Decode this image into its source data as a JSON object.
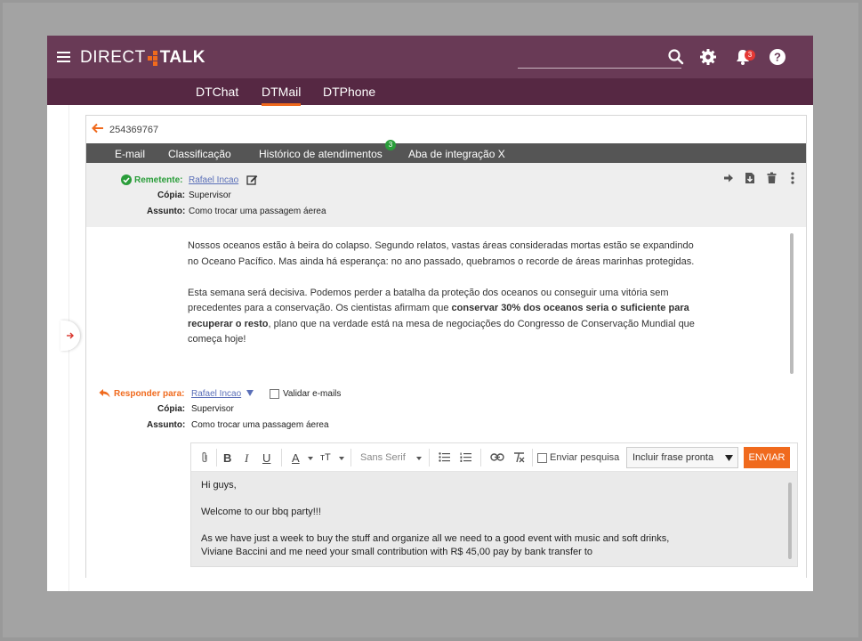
{
  "header": {
    "brand_left": "DIRECT",
    "brand_right": "TALK",
    "notification_count": "3",
    "icons": [
      "menu-icon",
      "search-icon",
      "gear-icon",
      "bell-icon",
      "help-icon"
    ]
  },
  "app_tabs": [
    {
      "label": "DTChat"
    },
    {
      "label": "DTMail"
    },
    {
      "label": "DTPhone"
    }
  ],
  "ticket": {
    "id": "254369767"
  },
  "sub_tabs": [
    {
      "label": "E-mail"
    },
    {
      "label": "Classificação"
    },
    {
      "label": "Histórico de atendimentos"
    },
    {
      "label": "Aba de integração X"
    }
  ],
  "history_count": "3",
  "email": {
    "sender_label": "Remetente:",
    "sender_value": "Rafael Incao",
    "cc_label": "Cópia:",
    "cc_value": "Supervisor",
    "subject_label": "Assunto:",
    "subject_value": "Como trocar uma passagem áerea",
    "body_p1": "Nossos oceanos estão à beira do colapso. Segundo relatos, vastas áreas consideradas mortas estão se expandindo no Oceano Pacífico. Mas ainda há esperança: no ano passado, quebramos o recorde de áreas marinhas protegidas.",
    "body_p2_a": "Esta semana será decisiva. Podemos perder a batalha da proteção dos oceanos ou conseguir uma vitória sem precedentes para a conservação. Os cientistas afirmam que ",
    "body_p2_bold": "conservar 30% dos oceanos seria o suficiente para recuperar o resto",
    "body_p2_c": ", plano que na verdade está na mesa de negociações do Congresso de Conservação Mundial que começa hoje!"
  },
  "reply": {
    "reply_label": "Responder para:",
    "reply_value": "Rafael Incao",
    "validate_label": "Validar e-mails",
    "cc_label": "Cópia:",
    "cc_value": "Supervisor",
    "subject_label": "Assunto:",
    "subject_value": "Como trocar uma passagem áerea"
  },
  "editor": {
    "font_label": "Sans Serif",
    "send_survey_label": "Enviar pesquisa",
    "insert_phrase_label": "Incluir frase pronta",
    "send_button": "ENVIAR",
    "line1": "Hi guys,",
    "line2": "Welcome to our bbq party!!!",
    "line3": "As we have just a week to buy the stuff and organize all we need to a good event with music and soft drinks,",
    "line4": "Viviane Baccini and me need your small contribution with R$ 45,00 pay by bank transfer to"
  },
  "colors": {
    "topbar": "#693a56",
    "tabbar": "#562843",
    "accent": "#f06a1d",
    "success": "#2a9d3a",
    "link": "#5a6fb8"
  }
}
